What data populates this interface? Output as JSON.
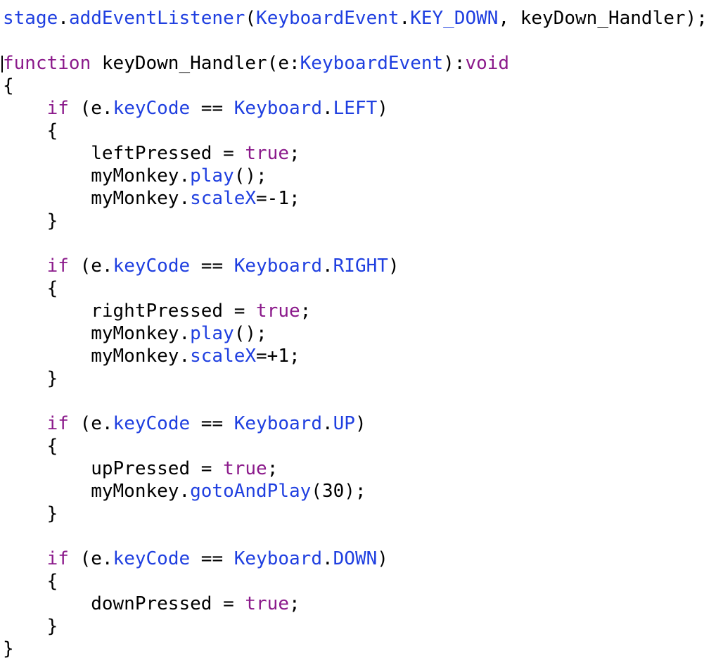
{
  "code": {
    "language": "ActionScript",
    "colors": {
      "keyword": "#8b1a8b",
      "api": "#1f3fe0",
      "plain": "#000000",
      "background": "#ffffff"
    },
    "cursor_line": 3,
    "lines": [
      [
        [
          "api",
          "stage"
        ],
        [
          "plain",
          "."
        ],
        [
          "api",
          "addEventListener"
        ],
        [
          "plain",
          "("
        ],
        [
          "api",
          "KeyboardEvent"
        ],
        [
          "plain",
          "."
        ],
        [
          "api",
          "KEY_DOWN"
        ],
        [
          "plain",
          ", keyDown_Handler);"
        ]
      ],
      [],
      [
        [
          "kw",
          "function"
        ],
        [
          "plain",
          " keyDown_Handler(e:"
        ],
        [
          "api",
          "KeyboardEvent"
        ],
        [
          "plain",
          "):"
        ],
        [
          "kw",
          "void"
        ]
      ],
      [
        [
          "plain",
          "{"
        ]
      ],
      [
        [
          "plain",
          "    "
        ],
        [
          "kw",
          "if"
        ],
        [
          "plain",
          " (e."
        ],
        [
          "api",
          "keyCode"
        ],
        [
          "plain",
          " == "
        ],
        [
          "api",
          "Keyboard"
        ],
        [
          "plain",
          "."
        ],
        [
          "api",
          "LEFT"
        ],
        [
          "plain",
          ")"
        ]
      ],
      [
        [
          "plain",
          "    {"
        ]
      ],
      [
        [
          "plain",
          "        leftPressed = "
        ],
        [
          "kw",
          "true"
        ],
        [
          "plain",
          ";"
        ]
      ],
      [
        [
          "plain",
          "        myMonkey."
        ],
        [
          "api",
          "play"
        ],
        [
          "plain",
          "();"
        ]
      ],
      [
        [
          "plain",
          "        myMonkey."
        ],
        [
          "api",
          "scaleX"
        ],
        [
          "plain",
          "=-1;"
        ]
      ],
      [
        [
          "plain",
          "    }"
        ]
      ],
      [],
      [
        [
          "plain",
          "    "
        ],
        [
          "kw",
          "if"
        ],
        [
          "plain",
          " (e."
        ],
        [
          "api",
          "keyCode"
        ],
        [
          "plain",
          " == "
        ],
        [
          "api",
          "Keyboard"
        ],
        [
          "plain",
          "."
        ],
        [
          "api",
          "RIGHT"
        ],
        [
          "plain",
          ")"
        ]
      ],
      [
        [
          "plain",
          "    {"
        ]
      ],
      [
        [
          "plain",
          "        rightPressed = "
        ],
        [
          "kw",
          "true"
        ],
        [
          "plain",
          ";"
        ]
      ],
      [
        [
          "plain",
          "        myMonkey."
        ],
        [
          "api",
          "play"
        ],
        [
          "plain",
          "();"
        ]
      ],
      [
        [
          "plain",
          "        myMonkey."
        ],
        [
          "api",
          "scaleX"
        ],
        [
          "plain",
          "=+1;"
        ]
      ],
      [
        [
          "plain",
          "    }"
        ]
      ],
      [],
      [
        [
          "plain",
          "    "
        ],
        [
          "kw",
          "if"
        ],
        [
          "plain",
          " (e."
        ],
        [
          "api",
          "keyCode"
        ],
        [
          "plain",
          " == "
        ],
        [
          "api",
          "Keyboard"
        ],
        [
          "plain",
          "."
        ],
        [
          "api",
          "UP"
        ],
        [
          "plain",
          ")"
        ]
      ],
      [
        [
          "plain",
          "    {"
        ]
      ],
      [
        [
          "plain",
          "        upPressed = "
        ],
        [
          "kw",
          "true"
        ],
        [
          "plain",
          ";"
        ]
      ],
      [
        [
          "plain",
          "        myMonkey."
        ],
        [
          "api",
          "gotoAndPlay"
        ],
        [
          "plain",
          "(30);"
        ]
      ],
      [
        [
          "plain",
          "    }"
        ]
      ],
      [],
      [
        [
          "plain",
          "    "
        ],
        [
          "kw",
          "if"
        ],
        [
          "plain",
          " (e."
        ],
        [
          "api",
          "keyCode"
        ],
        [
          "plain",
          " == "
        ],
        [
          "api",
          "Keyboard"
        ],
        [
          "plain",
          "."
        ],
        [
          "api",
          "DOWN"
        ],
        [
          "plain",
          ")"
        ]
      ],
      [
        [
          "plain",
          "    {"
        ]
      ],
      [
        [
          "plain",
          "        downPressed = "
        ],
        [
          "kw",
          "true"
        ],
        [
          "plain",
          ";"
        ]
      ],
      [
        [
          "plain",
          "    }"
        ]
      ],
      [
        [
          "plain",
          "}"
        ]
      ]
    ]
  }
}
